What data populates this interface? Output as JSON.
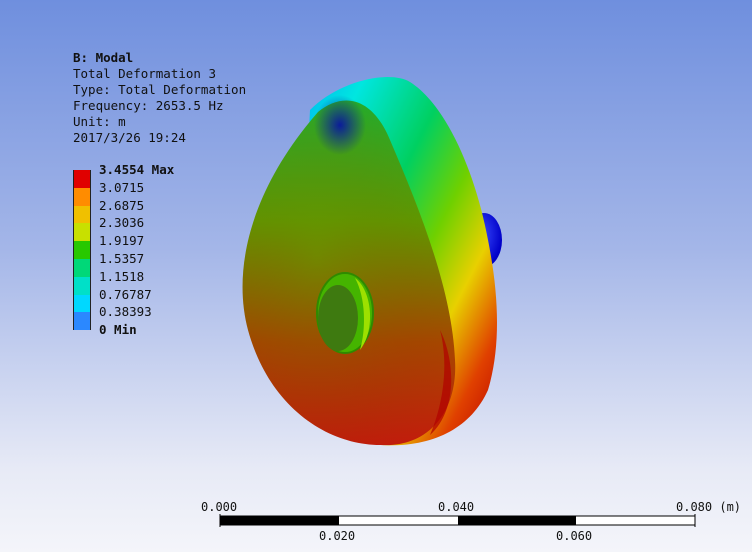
{
  "info": {
    "title": "B: Modal",
    "result": "Total Deformation 3",
    "type": "Type: Total Deformation",
    "frequency": "Frequency: 2653.5 Hz",
    "unit": "Unit: m",
    "timestamp": "2017/3/26 19:24"
  },
  "legend": [
    {
      "label": "3.4554 Max",
      "color": "#e00000",
      "bold": true
    },
    {
      "label": "3.0715",
      "color": "#ff8c00",
      "bold": false
    },
    {
      "label": "2.6875",
      "color": "#f0c000",
      "bold": false
    },
    {
      "label": "2.3036",
      "color": "#c8e000",
      "bold": false
    },
    {
      "label": "1.9197",
      "color": "#28c800",
      "bold": false
    },
    {
      "label": "1.5357",
      "color": "#00d878",
      "bold": false
    },
    {
      "label": "1.1518",
      "color": "#00e0c8",
      "bold": false
    },
    {
      "label": "0.76787",
      "color": "#00d8ff",
      "bold": false
    },
    {
      "label": "0.38393",
      "color": "#2b88ff",
      "bold": false
    },
    {
      "label": "0 Min",
      "color": "#0000e0",
      "bold": true
    }
  ],
  "scale": {
    "top_labels": [
      "0.000",
      "0.040",
      "0.080 (m)"
    ],
    "bottom_labels": [
      "0.020",
      "0.060"
    ]
  }
}
